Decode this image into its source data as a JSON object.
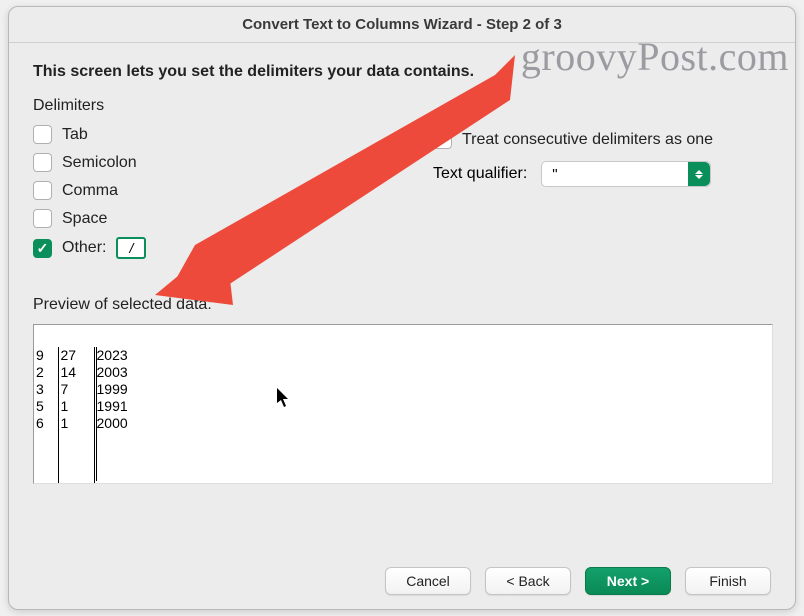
{
  "title": "Convert Text to Columns Wizard - Step 2 of 3",
  "watermark": "groovyPost.com",
  "instruction": "This screen lets you set the delimiters your data contains.",
  "delimiters": {
    "heading": "Delimiters",
    "tab": {
      "label": "Tab",
      "checked": false
    },
    "semicolon": {
      "label": "Semicolon",
      "checked": false
    },
    "comma": {
      "label": "Comma",
      "checked": false
    },
    "space": {
      "label": "Space",
      "checked": false
    },
    "other": {
      "label": "Other:",
      "checked": true,
      "value": "/"
    }
  },
  "consecutive": {
    "label": "Treat consecutive delimiters as one",
    "checked": false
  },
  "text_qualifier": {
    "label": "Text qualifier:",
    "value": "\""
  },
  "preview": {
    "label": "Preview of selected data:",
    "rows": [
      {
        "c1": "9",
        "c2": "27",
        "c3": "2023"
      },
      {
        "c1": "2",
        "c2": "14",
        "c3": "2003"
      },
      {
        "c1": "3",
        "c2": "7",
        "c3": "1999"
      },
      {
        "c1": "5",
        "c2": "1",
        "c3": "1991"
      },
      {
        "c1": "6",
        "c2": "1",
        "c3": "2000"
      }
    ]
  },
  "buttons": {
    "cancel": "Cancel",
    "back": "< Back",
    "next": "Next >",
    "finish": "Finish"
  }
}
